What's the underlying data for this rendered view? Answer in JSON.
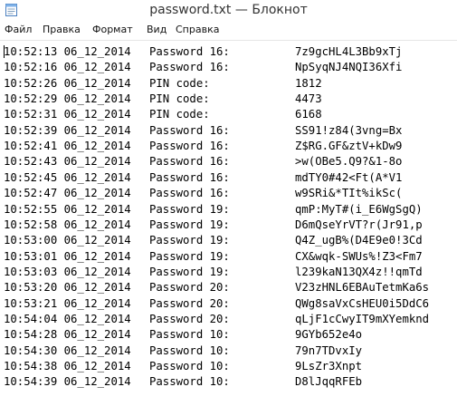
{
  "window": {
    "title": "password.txt — Блокнот"
  },
  "menu": [
    "Файл",
    "Правка",
    "Формат",
    "Вид",
    "Справка"
  ],
  "lines": [
    {
      "stamp": "10:52:13 06_12_2014",
      "label": "Password 16:",
      "value": "7z9gcHL4L3Bb9xTj"
    },
    {
      "stamp": "10:52:16 06_12_2014",
      "label": "Password 16:",
      "value": "NpSyqNJ4NQI36Xfi"
    },
    {
      "stamp": "10:52:26 06_12_2014",
      "label": "PIN code:",
      "value": "1812"
    },
    {
      "stamp": "10:52:29 06_12_2014",
      "label": "PIN code:",
      "value": "4473"
    },
    {
      "stamp": "10:52:31 06_12_2014",
      "label": "PIN code:",
      "value": "6168"
    },
    {
      "stamp": "10:52:39 06_12_2014",
      "label": "Password 16:",
      "value": "SS91!z84(3vng=Bx"
    },
    {
      "stamp": "10:52:41 06_12_2014",
      "label": "Password 16:",
      "value": "Z$RG.GF&ztV+kDw9"
    },
    {
      "stamp": "10:52:43 06_12_2014",
      "label": "Password 16:",
      "value": ">w(OBe5.Q9?&1-8o"
    },
    {
      "stamp": "10:52:45 06_12_2014",
      "label": "Password 16:",
      "value": "mdTY0#42<Ft(A*V1"
    },
    {
      "stamp": "10:52:47 06_12_2014",
      "label": "Password 16:",
      "value": "w9SRi&*TIt%ikSc("
    },
    {
      "stamp": "10:52:55 06_12_2014",
      "label": "Password 19:",
      "value": "qmP:MyT#(i_E6WgSgQ)"
    },
    {
      "stamp": "10:52:58 06_12_2014",
      "label": "Password 19:",
      "value": "D6mQseYrVT?r(Jr91,p"
    },
    {
      "stamp": "10:53:00 06_12_2014",
      "label": "Password 19:",
      "value": "Q4Z_ugB%(D4E9e0!3Cd"
    },
    {
      "stamp": "10:53:01 06_12_2014",
      "label": "Password 19:",
      "value": "CX&wqk-SWUs%!Z3<Fm7"
    },
    {
      "stamp": "10:53:03 06_12_2014",
      "label": "Password 19:",
      "value": "l239kaN13QX4z!!qmTd"
    },
    {
      "stamp": "10:53:20 06_12_2014",
      "label": "Password 20:",
      "value": "V23zHNL6EBAuTetmKa6s"
    },
    {
      "stamp": "10:53:21 06_12_2014",
      "label": "Password 20:",
      "value": "QWg8saVxCsHEU0i5DdC6"
    },
    {
      "stamp": "10:54:04 06_12_2014",
      "label": "Password 20:",
      "value": "qLjF1cCwyIT9mXYemknd"
    },
    {
      "stamp": "10:54:28 06_12_2014",
      "label": "Password 10:",
      "value": "9GYb652e4o"
    },
    {
      "stamp": "10:54:30 06_12_2014",
      "label": "Password 10:",
      "value": "79n7TDvxIy"
    },
    {
      "stamp": "10:54:38 06_12_2014",
      "label": "Password 10:",
      "value": "9LsZr3Xnpt"
    },
    {
      "stamp": "10:54:39 06_12_2014",
      "label": "Password 10:",
      "value": "D8lJqqRFEb"
    }
  ]
}
